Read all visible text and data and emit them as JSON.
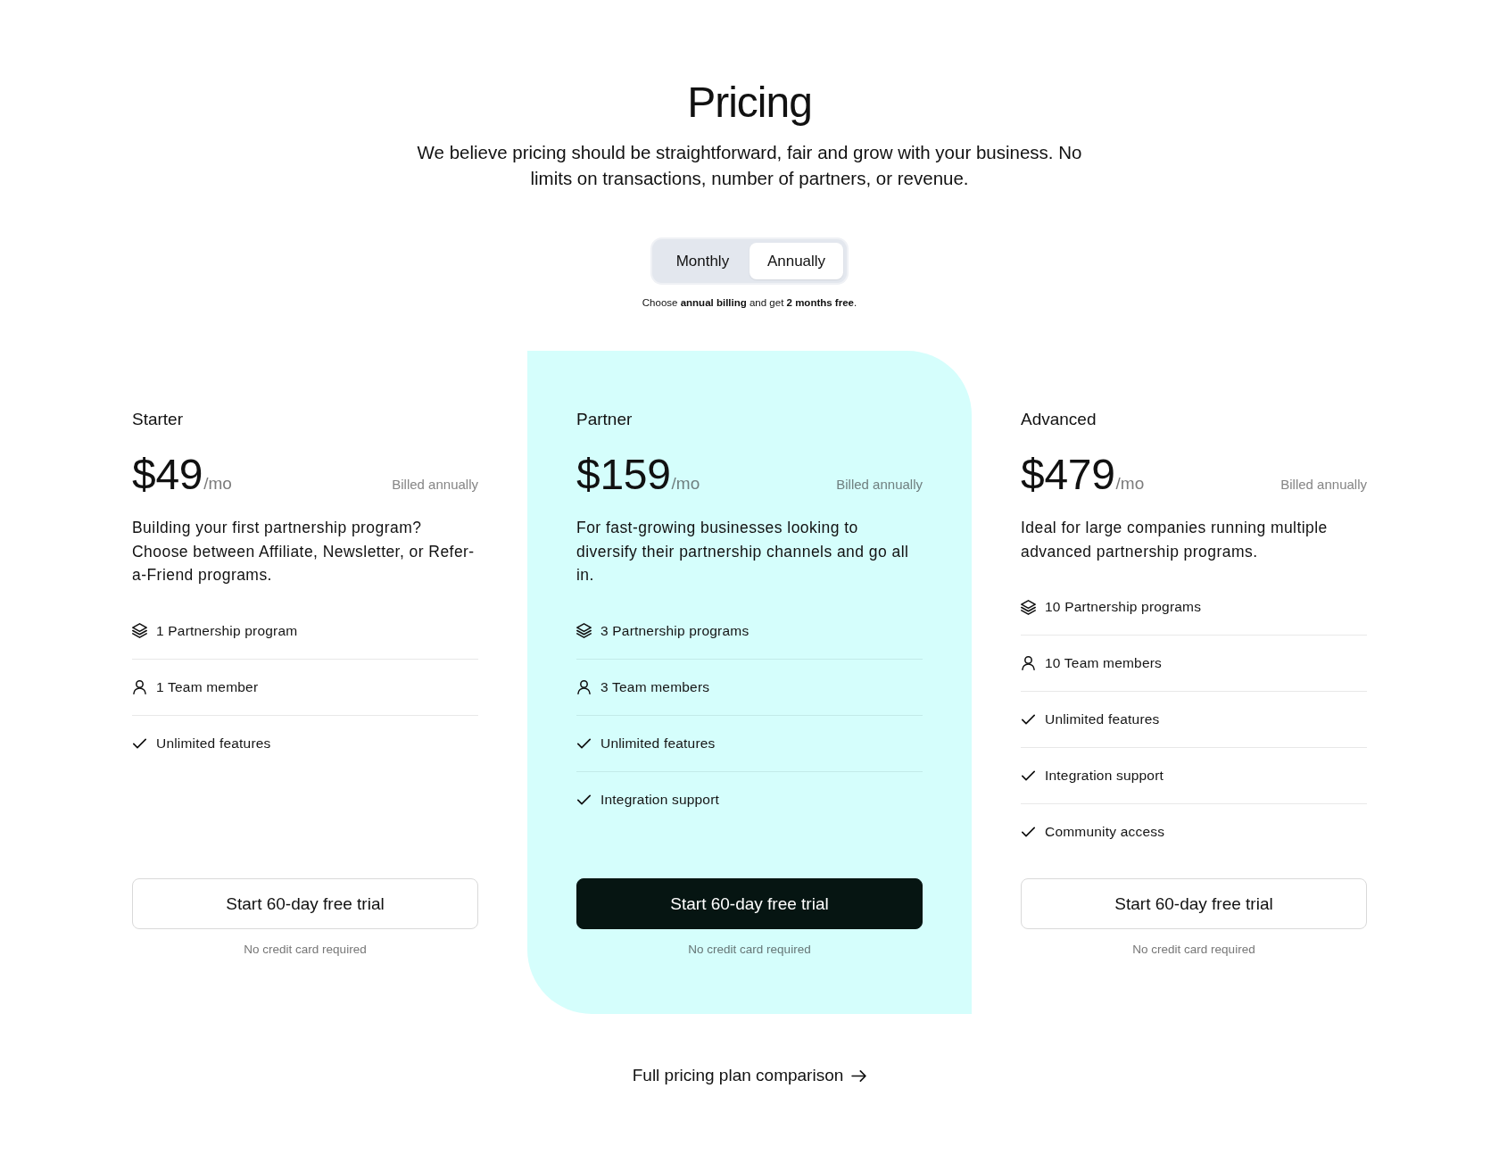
{
  "header": {
    "title": "Pricing",
    "subtitle": "We believe pricing should be straightforward, fair and grow with your business. No limits on transactions, number of partners, or revenue."
  },
  "billing_toggle": {
    "options": [
      {
        "label": "Monthly",
        "selected": false
      },
      {
        "label": "Annually",
        "selected": true
      }
    ],
    "note": "Choose **annual billing** and get **2 months free**."
  },
  "plans": [
    {
      "name": "Starter",
      "price": "$49",
      "period": "/mo",
      "billing": "Billed annually",
      "description": "Building your first partnership program? Choose between Affiliate, Newsletter, or Refer-a-Friend programs.",
      "highlighted": false,
      "features": [
        {
          "kind": "programs",
          "text": "1 Partnership program"
        },
        {
          "kind": "members",
          "text": "1 Team member"
        },
        {
          "kind": "check",
          "text": "Unlimited features"
        }
      ],
      "button": "Start 60-day free trial",
      "note": "No credit card required"
    },
    {
      "name": "Partner",
      "price": "$159",
      "period": "/mo",
      "billing": "Billed annually",
      "description": "For fast-growing businesses looking to diversify their partnership channels and go all in.",
      "highlighted": true,
      "features": [
        {
          "kind": "programs",
          "text": "3 Partnership programs"
        },
        {
          "kind": "members",
          "text": "3 Team members"
        },
        {
          "kind": "check",
          "text": "Unlimited features"
        },
        {
          "kind": "check",
          "text": "Integration support"
        }
      ],
      "button": "Start 60-day free trial",
      "note": "No credit card required"
    },
    {
      "name": "Advanced",
      "price": "$479",
      "period": "/mo",
      "billing": "Billed annually",
      "description": "Ideal for large companies running multiple advanced partnership programs.",
      "highlighted": false,
      "features": [
        {
          "kind": "programs",
          "text": "10 Partnership programs"
        },
        {
          "kind": "members",
          "text": "10 Team members"
        },
        {
          "kind": "check",
          "text": "Unlimited features"
        },
        {
          "kind": "check",
          "text": "Integration support"
        },
        {
          "kind": "check",
          "text": "Community access"
        }
      ],
      "button": "Start 60-day free trial",
      "note": "No credit card required"
    }
  ],
  "comparison_link": {
    "label": "Full pricing plan comparison"
  }
}
